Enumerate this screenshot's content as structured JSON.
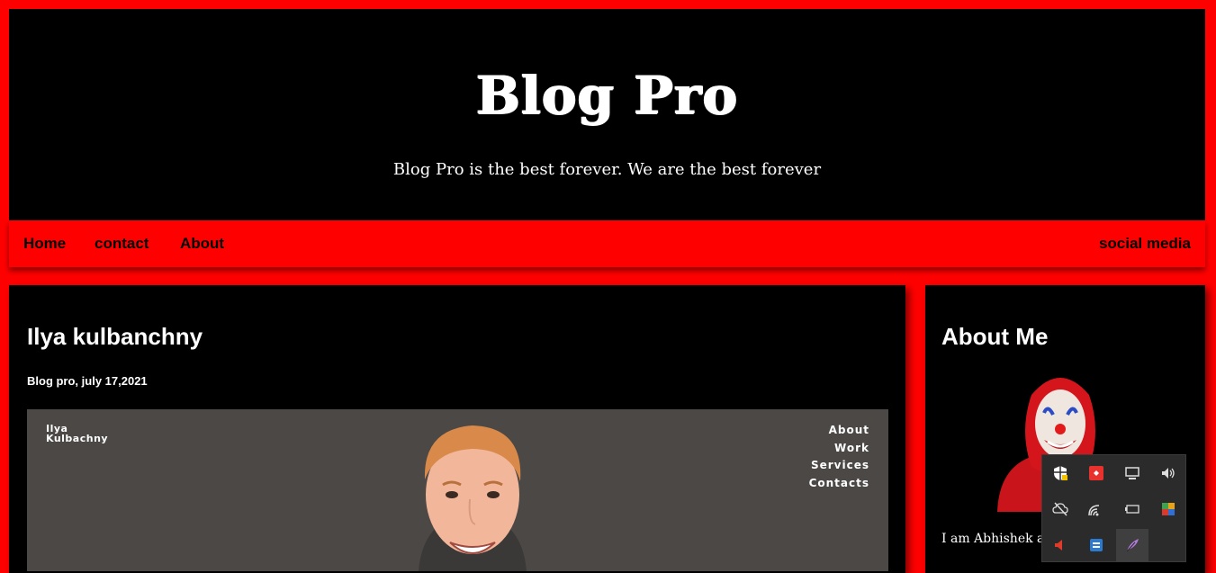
{
  "header": {
    "title": "Blog Pro",
    "tagline": "Blog Pro is the best forever. We are the best forever"
  },
  "nav": {
    "items": [
      {
        "label": "Home"
      },
      {
        "label": "contact"
      },
      {
        "label": "About"
      }
    ],
    "right_label": "social media"
  },
  "post": {
    "title": "Ilya kulbanchny",
    "meta": "Blog pro, july 17,2021",
    "image": {
      "name_line1": "Ilya",
      "name_line2": "Kulbachny",
      "menu": [
        "About",
        "Work",
        "Services",
        "Contacts"
      ]
    }
  },
  "sidebar": {
    "title": "About Me",
    "text": "I am Abhishek a passionate blogger."
  },
  "tray": {
    "icons": [
      "security-warning-icon",
      "anydesk-icon",
      "display-icon",
      "volume-icon",
      "cloud-off-icon",
      "wifi-icon",
      "battery-icon",
      "app-grid-icon",
      "speaker-red-icon",
      "network-app-icon",
      "feather-icon"
    ]
  },
  "colors": {
    "accent": "#ff0000",
    "panel": "#000000",
    "text": "#ffffff",
    "tray_bg": "#2b2b2b"
  }
}
